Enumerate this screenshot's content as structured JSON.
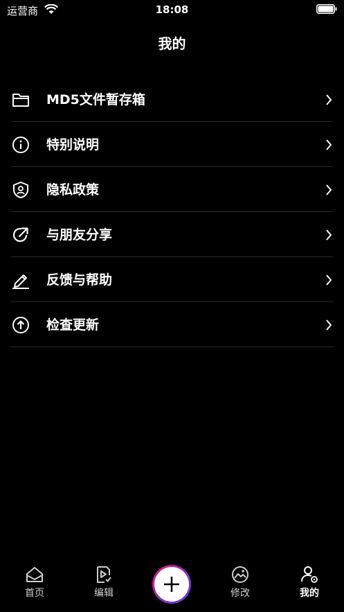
{
  "status_bar": {
    "carrier": "运营商",
    "time": "18:08"
  },
  "header": {
    "title": "我的"
  },
  "menu": {
    "items": [
      {
        "label": "MD5文件暂存箱",
        "icon": "folder-icon"
      },
      {
        "label": "特别说明",
        "icon": "info-icon"
      },
      {
        "label": "隐私政策",
        "icon": "privacy-shield-icon"
      },
      {
        "label": "与朋友分享",
        "icon": "share-icon"
      },
      {
        "label": "反馈与帮助",
        "icon": "pencil-icon"
      },
      {
        "label": "检查更新",
        "icon": "upload-arrow-icon"
      }
    ]
  },
  "tab_bar": {
    "home": "首页",
    "edit": "编辑",
    "modify": "修改",
    "mine": "我的"
  }
}
